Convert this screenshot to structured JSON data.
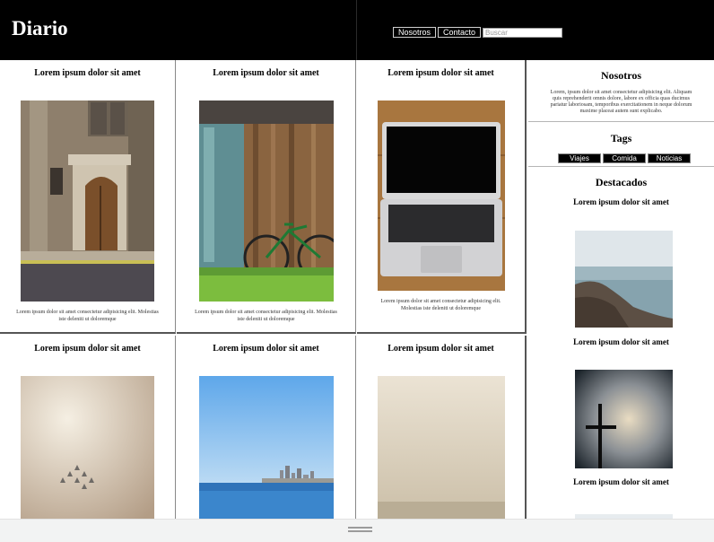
{
  "header": {
    "brand": "Diario",
    "nav": [
      "Nosotros",
      "Contacto"
    ],
    "search_placeholder": "Buscar"
  },
  "posts": [
    {
      "title": "Lorem ipsum dolor sit amet",
      "text": "Lorem ipsum dolor sit amet consectetur adipisicing elit. Molestias iste deleniti ut doloremque",
      "image": "old-building-door-photo"
    },
    {
      "title": "Lorem ipsum dolor sit amet",
      "text": "Lorem ipsum dolor sit amet consectetur adipisicing elit. Molestias iste deleniti ut doloremque",
      "image": "bicycle-wooden-wall-photo"
    },
    {
      "title": "Lorem ipsum dolor sit amet",
      "text": "Lorem ipsum dolor sit amet consectetur adipisicing elit. Molestias iste deleniti ut doloremque",
      "image": "laptop-photo"
    },
    {
      "title": "Lorem ipsum dolor sit amet",
      "text": "",
      "image": "jets-in-sky-photo"
    },
    {
      "title": "Lorem ipsum dolor sit amet",
      "text": "",
      "image": "city-skyline-photo"
    },
    {
      "title": "Lorem ipsum dolor sit amet",
      "text": "",
      "image": "foggy-landscape-photo"
    }
  ],
  "sidebar": {
    "about_title": "Nosotros",
    "about_text": "Lorem, ipsum dolor sit amet consectetur adipisicing elit. Aliquam quis reprehenderit omnis dolore, labore ex officia quas ducimus pariatur laboriosam, temporibus exercitationem in neque dolorum maxime placeat autem sunt explicabo.",
    "tags_title": "Tags",
    "tags": [
      "Viajes",
      "Comida",
      "Noticias"
    ],
    "featured_title": "Destacados",
    "featured": [
      {
        "title": "Lorem ipsum dolor sit amet",
        "image": "rocky-sea-photo"
      },
      {
        "title": "Lorem ipsum dolor sit amet",
        "image": "cross-cloudy-sky-photo"
      },
      {
        "title": "Lorem ipsum dolor sit amet",
        "image": "light-photo"
      }
    ]
  },
  "colors": {
    "header_bg": "#000000",
    "page_bg": "#ffffff",
    "bottombar_bg": "#f2f3f3"
  }
}
